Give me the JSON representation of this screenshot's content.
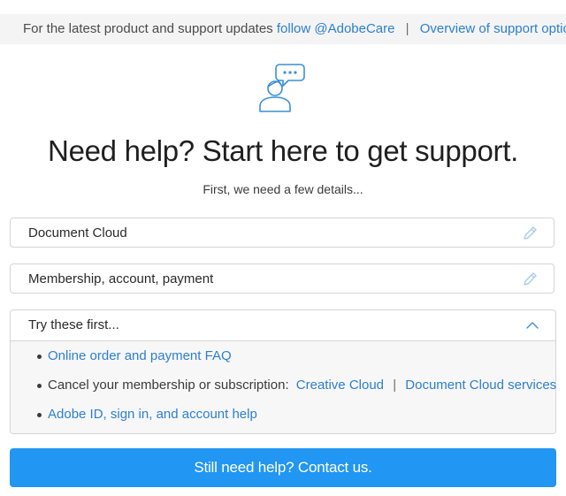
{
  "topbar": {
    "text": "For the latest product and support updates",
    "follow_link": "follow @AdobeCare",
    "separator": "|",
    "overview_link": "Overview of support options"
  },
  "hero": {
    "icon": "person-chat-icon",
    "headline": "Need help? Start here to get support.",
    "subhead": "First, we need a few details..."
  },
  "selections": [
    {
      "label": "Document Cloud",
      "icon": "pencil-icon"
    },
    {
      "label": "Membership, account, payment",
      "icon": "pencil-icon"
    }
  ],
  "try_panel": {
    "title": "Try these first...",
    "icon": "chevron-up-icon",
    "items": [
      {
        "link": "Online order and payment FAQ"
      },
      {
        "text": "Cancel your membership or subscription:",
        "link1": "Creative Cloud",
        "separator": "|",
        "link2": "Document Cloud services"
      },
      {
        "link": "Adobe ID, sign in, and account help"
      }
    ]
  },
  "cta": {
    "label": "Still need help? Contact us."
  },
  "colors": {
    "link": "#2d7fd0",
    "button": "#2196f3",
    "icon": "#3a8fd6"
  }
}
